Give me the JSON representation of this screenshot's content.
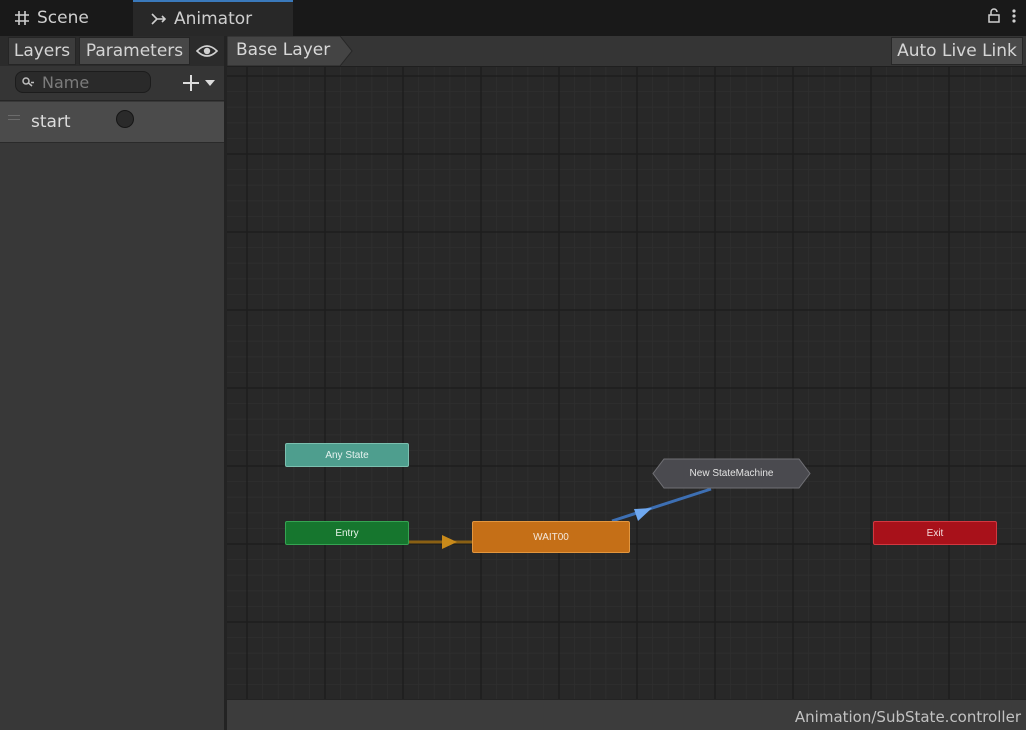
{
  "tabs": [
    {
      "label": "Scene",
      "icon": "grid-icon"
    },
    {
      "label": "Animator",
      "icon": "animator-icon"
    }
  ],
  "tab_actions": {
    "lock_icon": "lock-icon",
    "menu_icon": "kebab-menu-icon"
  },
  "left_panel": {
    "tabs": {
      "layers": "Layers",
      "parameters": "Parameters"
    },
    "visibility_icon": "eye-icon",
    "search": {
      "placeholder": "Name",
      "value": ""
    },
    "add_icon": "plus-icon",
    "parameters": [
      {
        "name": "start",
        "type": "trigger"
      }
    ]
  },
  "graph": {
    "breadcrumb": "Base Layer",
    "auto_live_link": "Auto Live Link",
    "nodes": {
      "any_state": "Any State",
      "entry": "Entry",
      "wait": "WAIT00",
      "state_machine": "New StateMachine",
      "exit": "Exit"
    },
    "colors": {
      "any_state": "#4e9e8e",
      "entry": "#16762e",
      "default_state": "#c56f17",
      "exit": "#a8111a",
      "state_machine": "#4a4a4f",
      "transition_default": "#8a6014",
      "transition": "#3d6fb3"
    }
  },
  "status_bar": {
    "path": "Animation/SubState.controller"
  }
}
